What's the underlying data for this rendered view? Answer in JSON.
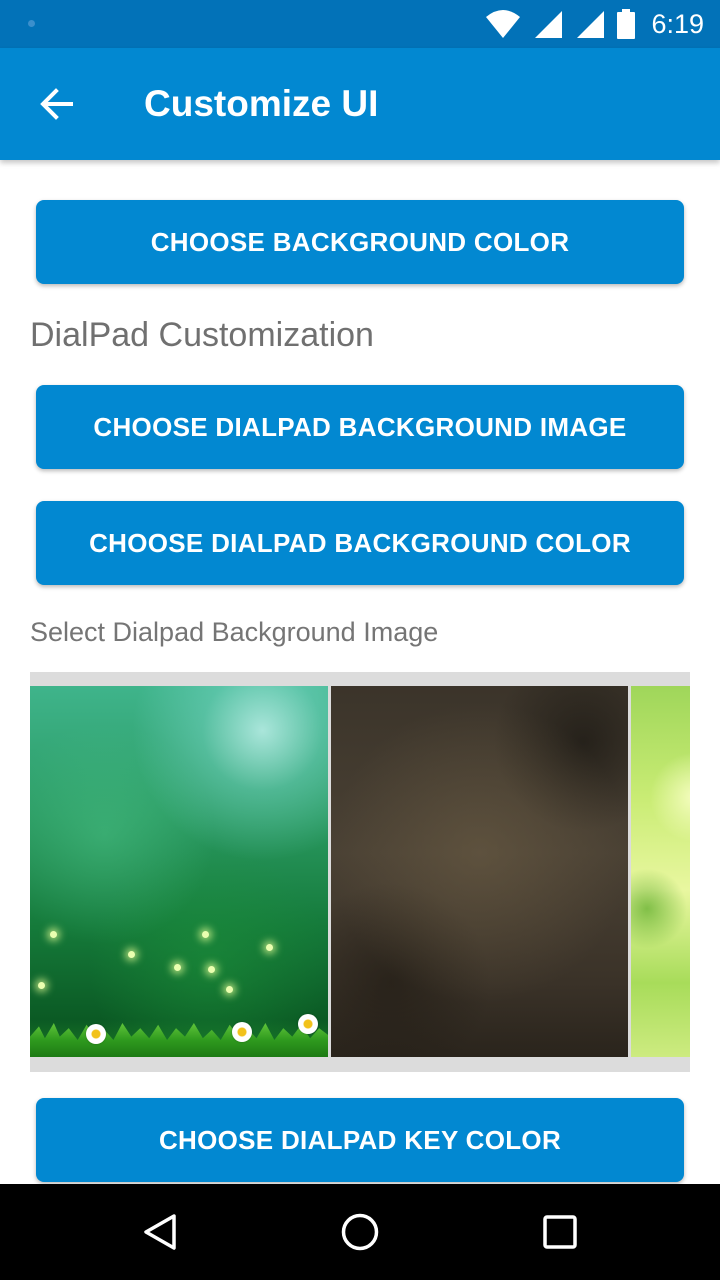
{
  "status_bar": {
    "time": "6:19",
    "icons": [
      "wifi-icon",
      "signal-icon",
      "signal-icon",
      "battery-icon"
    ]
  },
  "app_bar": {
    "title": "Customize UI",
    "back_icon": "arrow-back-icon"
  },
  "main": {
    "choose_background_color_label": "CHOOSE BACKGROUND COLOR",
    "dialpad_section_title": "DialPad Customization",
    "choose_dialpad_background_image_label": "CHOOSE DIALPAD BACKGROUND IMAGE",
    "choose_dialpad_background_color_label": "CHOOSE DIALPAD BACKGROUND COLOR",
    "select_image_label": "Select Dialpad Background Image",
    "gallery_images": [
      "green-bokeh-grass",
      "dark-grunge-texture",
      "green-leaves"
    ],
    "choose_dialpad_key_color_label": "CHOOSE DIALPAD KEY COLOR"
  },
  "nav_bar": {
    "buttons": [
      "back-triangle-icon",
      "home-circle-icon",
      "recents-square-icon"
    ]
  },
  "colors": {
    "status_bar": "#0272b8",
    "app_bar": "#0288d1",
    "button": "#0288d1",
    "button_text": "#ffffff",
    "section_text": "#707070",
    "gallery_background": "#dcdcdc"
  }
}
